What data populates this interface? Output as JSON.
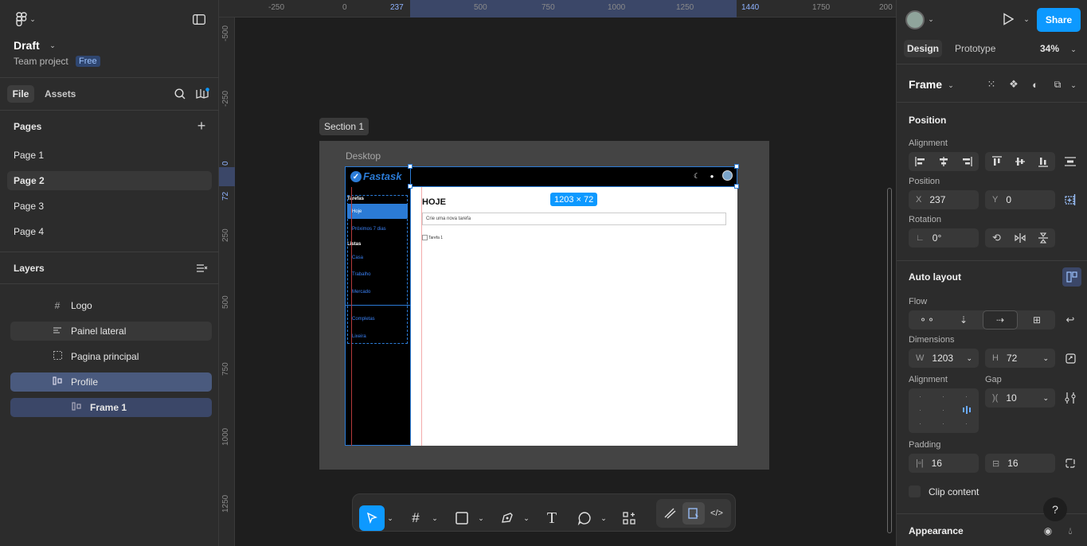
{
  "left_panel": {
    "file_name": "Draft",
    "project": "Team project",
    "plan_badge": "Free",
    "tabs": [
      "File",
      "Assets"
    ],
    "pages_title": "Pages",
    "pages": [
      "Page 1",
      "Page 2",
      "Page 3",
      "Page 4"
    ],
    "selected_page": "Page 2",
    "layers_title": "Layers",
    "layers": [
      {
        "name": "Logo",
        "icon": "frame-hash-icon"
      },
      {
        "name": "Painel lateral",
        "icon": "autolayout-vertical-icon"
      },
      {
        "name": "Pagina principal",
        "icon": "dashed-frame-icon"
      },
      {
        "name": "Profile",
        "icon": "autolayout-horizontal-icon"
      },
      {
        "name": "Frame 1",
        "icon": "autolayout-horizontal-icon"
      }
    ]
  },
  "rulers": {
    "top": [
      "-250",
      "0",
      "237",
      "500",
      "750",
      "1000",
      "1250",
      "1440",
      "1750",
      "200"
    ],
    "left": [
      "-500",
      "-250",
      "0",
      "72",
      "250",
      "500",
      "750",
      "1000",
      "1250"
    ]
  },
  "canvas": {
    "section_label": "Section 1",
    "frame_label": "Desktop",
    "size_badge": "1203 × 72",
    "app": {
      "logo": "Fastask",
      "heading": "HOJE",
      "input_placeholder": "Crie uma nova tarefa",
      "task": "Tarefa 1",
      "sidebar_title_tasks": "Tarefas",
      "sidebar_tasks": [
        "Hoje",
        "Próximos 7 dias"
      ],
      "sidebar_title_lists": "Listas",
      "sidebar_lists": [
        "Casa",
        "Trabalho",
        "Mercado"
      ],
      "sidebar_other": [
        "Completas",
        "Lixeira"
      ]
    }
  },
  "toolbar": {
    "tools": [
      "move-tool-icon",
      "frame-tool-icon",
      "rectangle-tool-icon",
      "pen-tool-icon",
      "text-tool-icon",
      "comment-tool-icon",
      "actions-icon",
      "draw-mode-icon",
      "design-mode-icon",
      "dev-mode-icon"
    ]
  },
  "right_panel": {
    "share_label": "Share",
    "tabs": [
      "Design",
      "Prototype"
    ],
    "zoom": "34%",
    "frame_label": "Frame",
    "position_title": "Position",
    "alignment_label": "Alignment",
    "position_label": "Position",
    "x_label": "X",
    "x_value": "237",
    "y_label": "Y",
    "y_value": "0",
    "rotation_label": "Rotation",
    "rotation_value": "0°",
    "autolayout_title": "Auto layout",
    "flow_label": "Flow",
    "dimensions_label": "Dimensions",
    "w_label": "W",
    "w_value": "1203",
    "h_label": "H",
    "h_value": "72",
    "alignment2_label": "Alignment",
    "gap_label": "Gap",
    "gap_value": "10",
    "padding_label": "Padding",
    "padding_h": "16",
    "padding_v": "16",
    "clip_label": "Clip content",
    "appearance_title": "Appearance",
    "help": "?"
  },
  "colors": {
    "accent": "#0d99ff",
    "selection": "#4a5a7e",
    "canvas": "#1e1e1e",
    "panel": "#2c2c2c"
  }
}
